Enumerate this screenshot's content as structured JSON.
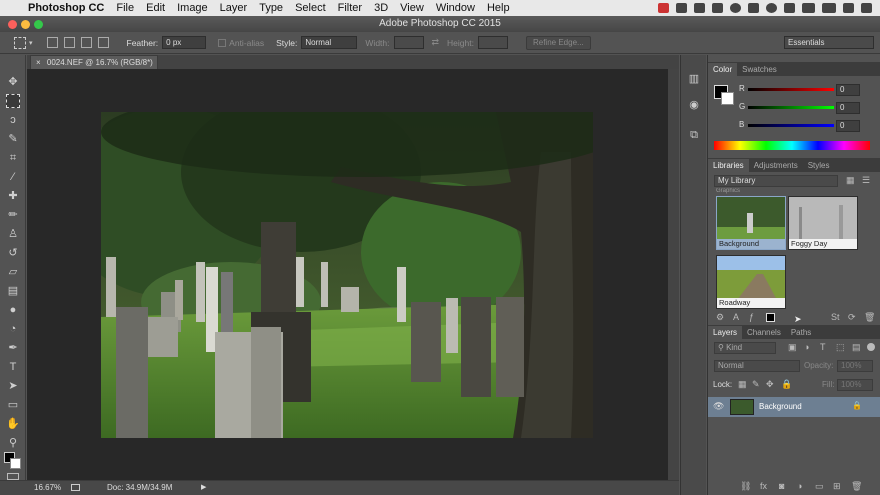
{
  "menubar": {
    "items": [
      "Photoshop CC",
      "File",
      "Edit",
      "Image",
      "Layer",
      "Type",
      "Select",
      "Filter",
      "3D",
      "View",
      "Window",
      "Help"
    ]
  },
  "window": {
    "title": "Adobe Photoshop CC 2015"
  },
  "options_bar": {
    "feather_label": "Feather:",
    "feather_value": "0 px",
    "antialias_label": "Anti-alias",
    "style_label": "Style:",
    "style_value": "Normal",
    "width_label": "Width:",
    "height_label": "Height:",
    "refine_edge_label": "Refine Edge...",
    "workspace_value": "Essentials"
  },
  "document": {
    "tab_label": "0024.NEF @ 16.7% (RGB/8*)",
    "close_glyph": "×"
  },
  "status": {
    "zoom": "16.67%",
    "doc_size": "Doc: 34.9M/34.9M"
  },
  "color_panel": {
    "tabs": [
      "Color",
      "Swatches"
    ],
    "sliders": [
      {
        "label": "R",
        "value": "0"
      },
      {
        "label": "G",
        "value": "0"
      },
      {
        "label": "B",
        "value": "0"
      }
    ]
  },
  "libraries_panel": {
    "tabs": [
      "Libraries",
      "Adjustments",
      "Styles"
    ],
    "library_name": "My Library",
    "section_label": "Graphics",
    "items": [
      {
        "label": "Background"
      },
      {
        "label": "Foggy Day"
      },
      {
        "label": "Roadway"
      }
    ]
  },
  "layers_panel": {
    "tabs": [
      "Layers",
      "Channels",
      "Paths"
    ],
    "filter_value": "Kind",
    "blend_mode": "Normal",
    "opacity_label": "Opacity:",
    "opacity_value": "100%",
    "lock_label": "Lock:",
    "fill_label": "Fill:",
    "fill_value": "100%",
    "layer_name": "Background"
  },
  "colors": {
    "panel_bg": "#535353",
    "canvas_bg": "#282828",
    "selected_layer": "#6d7f92"
  }
}
